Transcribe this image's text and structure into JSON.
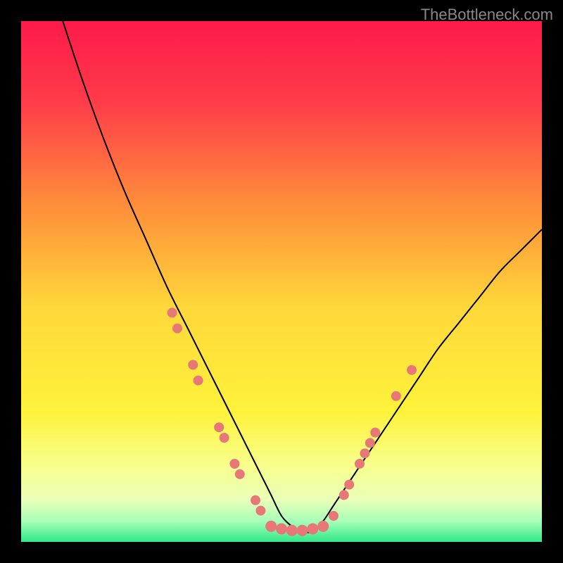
{
  "watermark": "TheBottleneck.com",
  "chart_data": {
    "type": "line",
    "title": "",
    "xlabel": "",
    "ylabel": "",
    "xlim": [
      0,
      100
    ],
    "ylim": [
      0,
      100
    ],
    "background_gradient": {
      "stops": [
        {
          "offset": 0,
          "color": "#ff1a4a"
        },
        {
          "offset": 15,
          "color": "#ff3a4a"
        },
        {
          "offset": 35,
          "color": "#ff8c3a"
        },
        {
          "offset": 55,
          "color": "#ffd83a"
        },
        {
          "offset": 75,
          "color": "#fff23a"
        },
        {
          "offset": 85,
          "color": "#f8ff8a"
        },
        {
          "offset": 92,
          "color": "#e8ffb8"
        },
        {
          "offset": 96,
          "color": "#a8ffb8"
        },
        {
          "offset": 100,
          "color": "#30e888"
        }
      ]
    },
    "series": [
      {
        "name": "bottleneck-curve",
        "color": "#000000",
        "x": [
          8,
          12,
          16,
          20,
          24,
          28,
          32,
          36,
          40,
          42,
          44,
          46,
          48,
          50,
          52,
          54,
          56,
          58,
          60,
          64,
          68,
          72,
          76,
          80,
          84,
          88,
          92,
          96,
          100
        ],
        "y": [
          100,
          88,
          77,
          67,
          58,
          49,
          41,
          33,
          25,
          21,
          17,
          13,
          9,
          5,
          3,
          2,
          2,
          4,
          7,
          13,
          19,
          25,
          31,
          37,
          42,
          47,
          52,
          56,
          60
        ]
      }
    ],
    "markers": [
      {
        "x": 29,
        "y": 44,
        "r": 7
      },
      {
        "x": 30,
        "y": 41,
        "r": 7
      },
      {
        "x": 33,
        "y": 34,
        "r": 7
      },
      {
        "x": 34,
        "y": 31,
        "r": 7
      },
      {
        "x": 38,
        "y": 22,
        "r": 7
      },
      {
        "x": 39,
        "y": 20,
        "r": 7
      },
      {
        "x": 41,
        "y": 15,
        "r": 7
      },
      {
        "x": 42,
        "y": 13,
        "r": 7
      },
      {
        "x": 45,
        "y": 8,
        "r": 7
      },
      {
        "x": 46,
        "y": 6,
        "r": 7
      },
      {
        "x": 48,
        "y": 3,
        "r": 8
      },
      {
        "x": 50,
        "y": 2.5,
        "r": 8
      },
      {
        "x": 52,
        "y": 2.2,
        "r": 8
      },
      {
        "x": 54,
        "y": 2.2,
        "r": 8
      },
      {
        "x": 56,
        "y": 2.5,
        "r": 8
      },
      {
        "x": 58,
        "y": 3,
        "r": 8
      },
      {
        "x": 60,
        "y": 5,
        "r": 7
      },
      {
        "x": 62,
        "y": 9,
        "r": 7
      },
      {
        "x": 63,
        "y": 11,
        "r": 7
      },
      {
        "x": 65,
        "y": 15,
        "r": 7
      },
      {
        "x": 66,
        "y": 17,
        "r": 7
      },
      {
        "x": 67,
        "y": 19,
        "r": 7
      },
      {
        "x": 68,
        "y": 21,
        "r": 7
      },
      {
        "x": 72,
        "y": 28,
        "r": 7
      },
      {
        "x": 75,
        "y": 33,
        "r": 7
      }
    ],
    "marker_color": "#e87878"
  }
}
